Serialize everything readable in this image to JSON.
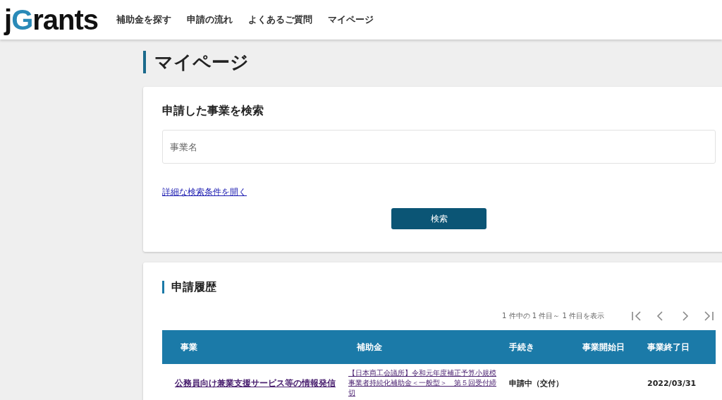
{
  "logo": [
    {
      "text": "j",
      "accent": false
    },
    {
      "text": "G",
      "accent": true
    },
    {
      "text": "rants",
      "accent": false
    }
  ],
  "nav": [
    "補助金を探す",
    "申請の流れ",
    "よくあるご質問",
    "マイページ"
  ],
  "page_title": "マイページ",
  "search": {
    "title": "申請した事業を検索",
    "placeholder": "事業名",
    "advanced_link": "詳細な検索条件を開く",
    "button": "検索"
  },
  "history": {
    "title": "申請履歴",
    "summary": "1 件中の 1 件目～ 1 件目を表示",
    "columns": [
      "事業",
      "補助金",
      "手続き",
      "事業開始日",
      "事業終了日"
    ],
    "rows": [
      {
        "project": "公務員向け兼業支援サービス等の情報発信",
        "subsidy": "【日本商工会議所】令和元年度補正予算小規模事業者持続化補助金＜一般型＞　第５回受付締切",
        "procedure": "申請中（交付）",
        "end": "2022/03/31"
      }
    ]
  }
}
